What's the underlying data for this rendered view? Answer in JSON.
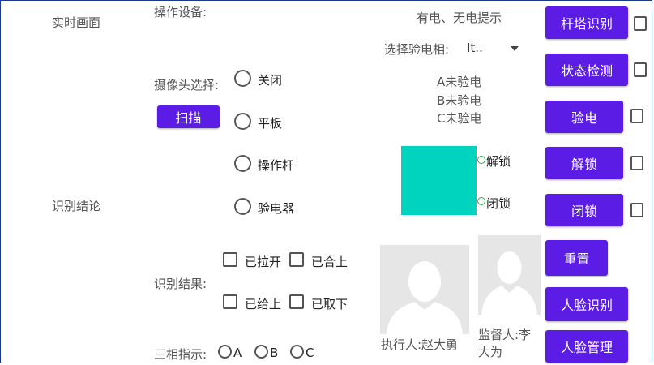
{
  "left": {
    "realtime_label": "实时画面",
    "result_label": "识别结论"
  },
  "device": {
    "label": "操作设备:"
  },
  "notice": "有电、无电提示",
  "phase_select": {
    "label": "选择验电相:",
    "value": "It.."
  },
  "camera": {
    "label": "摄像头选择:",
    "scan_button": "扫描",
    "options": [
      "关闭",
      "平板",
      "操作杆",
      "验电器"
    ]
  },
  "status_lines": [
    "A未验电",
    "B未验电",
    "C未验电"
  ],
  "lock": {
    "unlock": "解锁",
    "lock": "闭锁",
    "panel_color": "#00d4bf"
  },
  "recognition": {
    "label": "识别结果:",
    "options": [
      "已拉开",
      "已合上",
      "已给上",
      "已取下"
    ]
  },
  "three_phase": {
    "label": "三相指示:",
    "options": [
      "A",
      "B",
      "C"
    ]
  },
  "people": {
    "executor": "执行人:赵大勇",
    "supervisor": "监督人:李大为"
  },
  "buttons": {
    "tower": "杆塔识别",
    "state": "状态检测",
    "test": "验电",
    "unlock": "解锁",
    "lock": "闭锁",
    "reset": "重置",
    "face_recog": "人脸识别",
    "face_manage": "人脸管理"
  },
  "colors": {
    "accent": "#5b1ce6",
    "teal": "#00d4bf"
  }
}
